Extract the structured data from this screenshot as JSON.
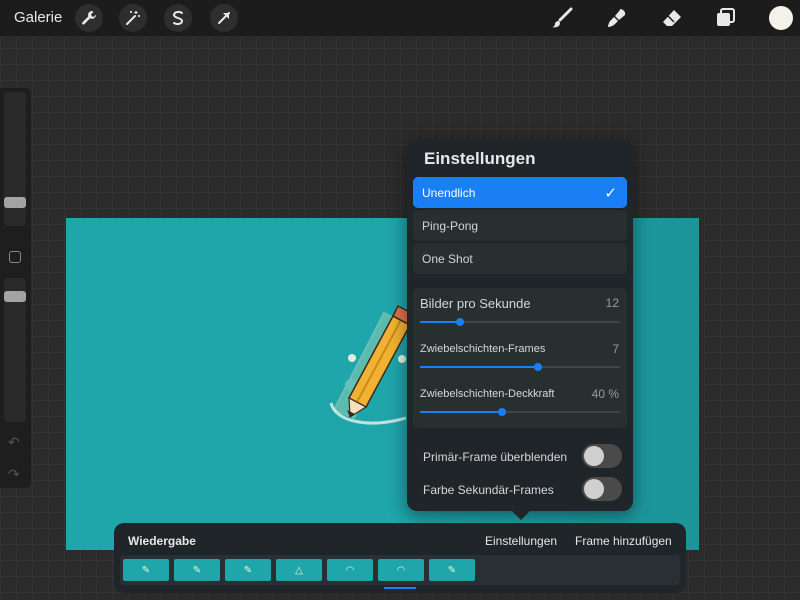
{
  "toolbar": {
    "gallery_label": "Galerie",
    "left_tools": [
      "wrench-icon",
      "magic-wand-icon",
      "selection-icon",
      "transform-arrow-icon"
    ],
    "right_tools": [
      "brush-icon",
      "smudge-icon",
      "eraser-icon",
      "layers-icon"
    ],
    "current_color": "#f4f1ea"
  },
  "settings": {
    "title": "Einstellungen",
    "modes": [
      {
        "label": "Unendlich",
        "selected": true
      },
      {
        "label": "Ping-Pong",
        "selected": false
      },
      {
        "label": "One Shot",
        "selected": false
      }
    ],
    "fps": {
      "label": "Bilder pro Sekunde",
      "value": "12",
      "fraction": 0.2
    },
    "onion_frames": {
      "label": "Zwiebelschichten-Frames",
      "value": "7",
      "fraction": 0.59
    },
    "onion_opacity": {
      "label": "Zwiebelschichten-Deckkraft",
      "value": "40 %",
      "fraction": 0.41
    },
    "blend_primary": {
      "label": "Primär-Frame überblenden",
      "on": false
    },
    "color_secondary": {
      "label": "Farbe Sekundär-Frames",
      "on": false
    }
  },
  "playback": {
    "title": "Wiedergabe",
    "settings_link": "Einstellungen",
    "add_frame_link": "Frame hinzufügen",
    "frames": [
      {
        "glyph": "✎"
      },
      {
        "glyph": "✎"
      },
      {
        "glyph": "✎"
      },
      {
        "glyph": "△"
      },
      {
        "glyph": "◠"
      },
      {
        "glyph": "◠"
      },
      {
        "glyph": "✎"
      }
    ],
    "active_frame": 6
  },
  "colors": {
    "accent": "#1a7ef5",
    "canvas": "#1fa6ab",
    "panel": "#1f2528"
  }
}
